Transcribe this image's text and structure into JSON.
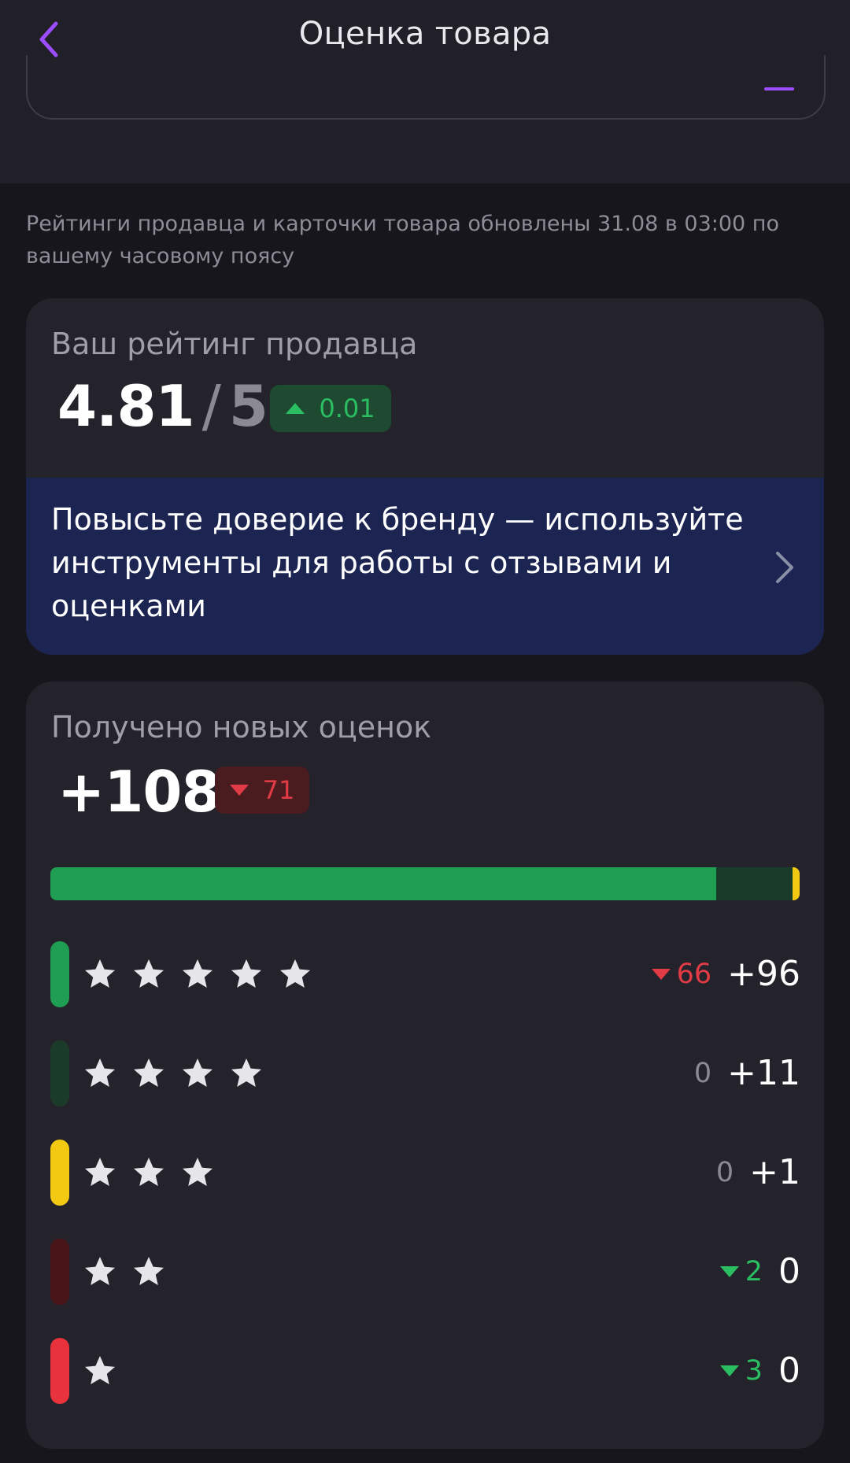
{
  "header": {
    "title": "Оценка товара",
    "back_icon": "chevron-left-icon",
    "accent_color": "#9b4dff"
  },
  "update_note": "Рейтинги продавца и карточки товара обновлены 31.08 в 03:00 по вашему часовому поясу",
  "seller_rating": {
    "label": "Ваш рейтинг продавца",
    "value": "4.81",
    "separator": "/",
    "max": "5",
    "change": "0.01",
    "change_direction": "up",
    "change_color": "#2bbd61"
  },
  "promo": {
    "text": "Повысьте доверие к бренду — используйте инструменты для работы с отзывами и оценками",
    "icon": "chevron-right-icon",
    "background": "#1c2552"
  },
  "new_ratings": {
    "label": "Получено новых оценок",
    "value": "+108",
    "change": "71",
    "change_direction": "down",
    "change_color": "#e13b45",
    "distribution": [
      {
        "stars": 5,
        "count": 96,
        "color": "#1f9d52"
      },
      {
        "stars": 4,
        "count": 11,
        "color": "#1b3b2a"
      },
      {
        "stars": 3,
        "count": 1,
        "color": "#f2c811"
      },
      {
        "stars": 2,
        "count": 0,
        "color": "#4a1518"
      },
      {
        "stars": 1,
        "count": 0,
        "color": "#e8323c"
      }
    ],
    "rows": [
      {
        "stars": 5,
        "delta": "66",
        "delta_type": "down-red",
        "count": "+96",
        "color": "#1f9d52"
      },
      {
        "stars": 4,
        "delta": "0",
        "delta_type": "neutral",
        "count": "+11",
        "color": "#1b3b2a"
      },
      {
        "stars": 3,
        "delta": "0",
        "delta_type": "neutral",
        "count": "+1",
        "color": "#f2c811"
      },
      {
        "stars": 2,
        "delta": "2",
        "delta_type": "down-green",
        "count": "0",
        "color": "#4a1518"
      },
      {
        "stars": 1,
        "delta": "3",
        "delta_type": "down-green",
        "count": "0",
        "color": "#e8323c"
      }
    ]
  }
}
